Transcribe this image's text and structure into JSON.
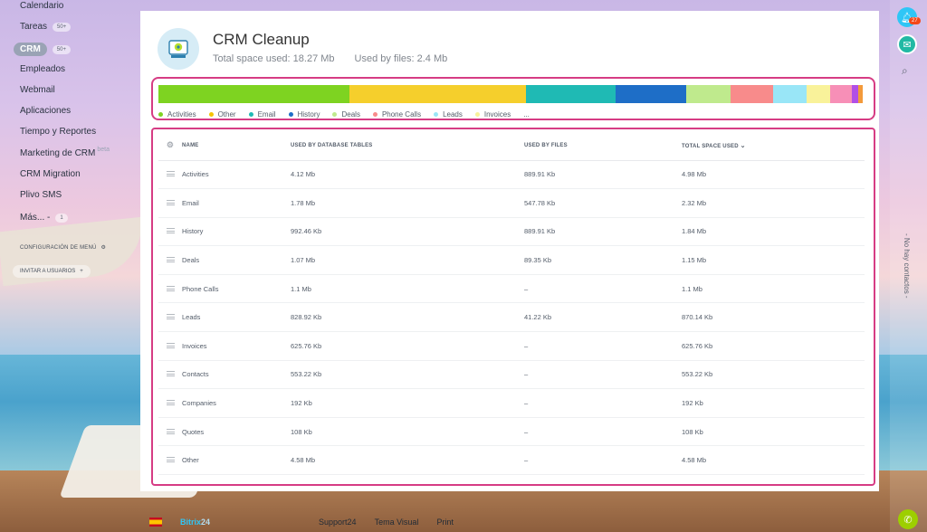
{
  "nav": {
    "items": [
      {
        "label": "Calendario"
      },
      {
        "label": "Tareas",
        "count": "50+"
      },
      {
        "label": "CRM",
        "count": "50+"
      },
      {
        "label": "Empleados"
      },
      {
        "label": "Webmail"
      },
      {
        "label": "Aplicaciones"
      },
      {
        "label": "Tiempo y Reportes"
      },
      {
        "label": "Marketing de CRM",
        "extra": "beta"
      },
      {
        "label": "CRM Migration"
      },
      {
        "label": "Plivo SMS"
      },
      {
        "label": "Más... -",
        "count": "1"
      }
    ],
    "config_label": "Configuración de menú",
    "invite_label": "Invitar a usuarios"
  },
  "header": {
    "title": "CRM Cleanup",
    "total_space": "Total space used: 18.27 Mb",
    "used_by_files": "Used by files: 2.4 Mb"
  },
  "usage_bar": {
    "segments": [
      {
        "name": "Activities",
        "fraction": 0.272,
        "color": "#7ed321"
      },
      {
        "name": "Other",
        "fraction": 0.251,
        "color": "#f5cf2c"
      },
      {
        "name": "Email",
        "fraction": 0.127,
        "color": "#1fbab4"
      },
      {
        "name": "History",
        "fraction": 0.101,
        "color": "#1e6ec7"
      },
      {
        "name": "Deals",
        "fraction": 0.063,
        "color": "#bfea8d"
      },
      {
        "name": "Phone Calls",
        "fraction": 0.06,
        "color": "#f88b8b"
      },
      {
        "name": "Leads",
        "fraction": 0.048,
        "color": "#99e6f7"
      },
      {
        "name": "Invoices",
        "fraction": 0.034,
        "color": "#f9f29a"
      },
      {
        "name": "Contacts",
        "fraction": 0.03,
        "color": "#f78fb7"
      },
      {
        "name": "Companies",
        "fraction": 0.01,
        "color": "#b14fe6"
      },
      {
        "name": "Quotes",
        "fraction": 0.006,
        "color": "#f39a3a"
      }
    ],
    "legend": [
      {
        "label": "Activities",
        "color": "#7ed321"
      },
      {
        "label": "Other",
        "color": "#f5c400"
      },
      {
        "label": "Email",
        "color": "#1fbab4"
      },
      {
        "label": "History",
        "color": "#1e6ec7"
      },
      {
        "label": "Deals",
        "color": "#bfea8d"
      },
      {
        "label": "Phone Calls",
        "color": "#f88b8b"
      },
      {
        "label": "Leads",
        "color": "#99e6f7"
      },
      {
        "label": "Invoices",
        "color": "#f9f29a"
      }
    ],
    "legend_more": "..."
  },
  "table": {
    "columns": [
      "Name",
      "Used by database tables",
      "Used by files",
      "Total space used"
    ],
    "sort_icon": "chevron-down-icon",
    "rows": [
      {
        "name": "Activities",
        "db": "4.12 Mb",
        "files": "889.91 Kb",
        "total": "4.98 Mb"
      },
      {
        "name": "Email",
        "db": "1.78 Mb",
        "files": "547.78 Kb",
        "total": "2.32 Mb"
      },
      {
        "name": "History",
        "db": "992.46 Kb",
        "files": "889.91 Kb",
        "total": "1.84 Mb"
      },
      {
        "name": "Deals",
        "db": "1.07 Mb",
        "files": "89.35 Kb",
        "total": "1.15 Mb"
      },
      {
        "name": "Phone Calls",
        "db": "1.1 Mb",
        "files": "–",
        "total": "1.1 Mb"
      },
      {
        "name": "Leads",
        "db": "828.92 Kb",
        "files": "41.22 Kb",
        "total": "870.14 Kb"
      },
      {
        "name": "Invoices",
        "db": "625.76 Kb",
        "files": "–",
        "total": "625.76 Kb"
      },
      {
        "name": "Contacts",
        "db": "553.22 Kb",
        "files": "–",
        "total": "553.22 Kb"
      },
      {
        "name": "Companies",
        "db": "192 Kb",
        "files": "–",
        "total": "192 Kb"
      },
      {
        "name": "Quotes",
        "db": "108 Kb",
        "files": "–",
        "total": "108 Kb"
      },
      {
        "name": "Other",
        "db": "4.58 Mb",
        "files": "–",
        "total": "4.58 Mb"
      }
    ]
  },
  "rightbar": {
    "notifications_count": "27",
    "contacts_label": "- No hay contactos -"
  },
  "footer": {
    "brand": "Bitrix",
    "brand_suffix": "24",
    "links": [
      "Support24",
      "Tema Visual",
      "Print"
    ]
  }
}
